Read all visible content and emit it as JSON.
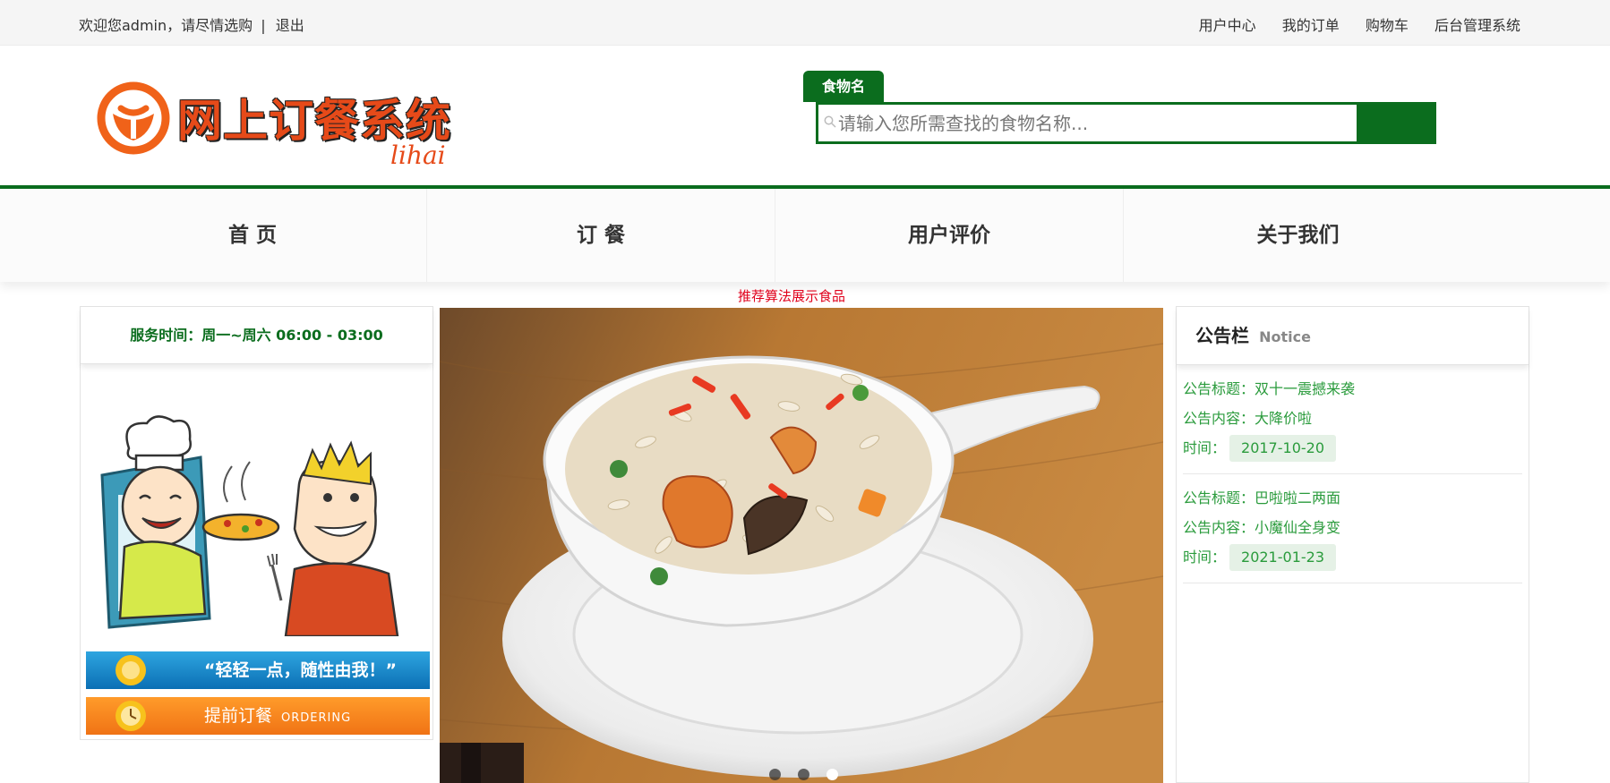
{
  "topbar": {
    "welcome": "欢迎您admin，请尽情选购",
    "separator": "|",
    "logout": "退出",
    "links": [
      "用户中心",
      "我的订单",
      "购物车",
      "后台管理系统"
    ]
  },
  "logo": {
    "title": "网上订餐系统",
    "signature": "lihai"
  },
  "search": {
    "tab_label": "食物名",
    "placeholder": "请输入您所需查找的食物名称..."
  },
  "nav": {
    "items": [
      "首 页",
      "订 餐",
      "用户评价",
      "关于我们"
    ]
  },
  "recommend_note": "推荐算法展示食品",
  "service": {
    "hours": "服务时间：周一~周六 06:00 - 03:00"
  },
  "banners": {
    "slogan": "“轻轻一点，随性由我！”",
    "order_cn": "提前订餐",
    "order_en": "ORDERING"
  },
  "carousel": {
    "slide_count": 3,
    "active_index": 2
  },
  "notice": {
    "title": "公告栏",
    "subtitle": "Notice",
    "title_label": "公告标题：",
    "content_label": "公告内容：",
    "time_label": "时间：",
    "items": [
      {
        "title": "双十一震撼来袭",
        "content": "大降价啦",
        "date": "2017-10-20"
      },
      {
        "title": "巴啦啦二两面",
        "content": "小魔仙全身变",
        "date": "2021-01-23"
      }
    ]
  },
  "colors": {
    "brand_green": "#0b6d1e",
    "notice_green": "#2a9b3c",
    "logo_orange": "#e64a19",
    "alert_red": "#e0001b"
  }
}
